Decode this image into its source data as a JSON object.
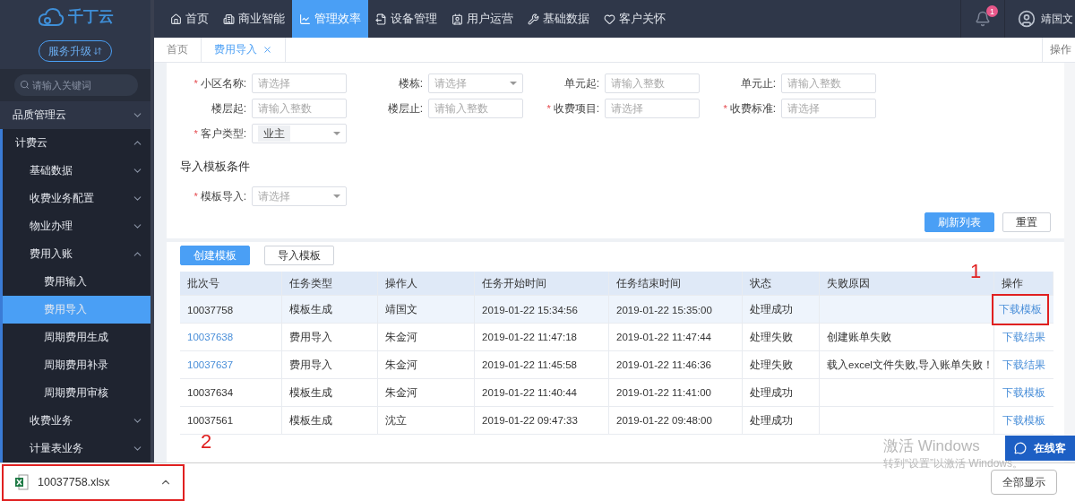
{
  "logo": {
    "text": "千丁云"
  },
  "upgrade_button": {
    "label": "服务升级"
  },
  "sidebar_search": {
    "placeholder": "请输入关键词"
  },
  "sidebar": {
    "items": [
      {
        "label": "品质管理云",
        "expanded": false,
        "selected": false
      },
      {
        "label": "计费云",
        "expanded": true,
        "selected": false,
        "children": [
          {
            "label": "基础数据",
            "expanded": false,
            "selected": false
          },
          {
            "label": "收费业务配置",
            "expanded": false,
            "selected": false
          },
          {
            "label": "物业办理",
            "expanded": false,
            "selected": false
          },
          {
            "label": "费用入账",
            "expanded": true,
            "selected": false,
            "children": [
              {
                "label": "费用输入",
                "selected": false
              },
              {
                "label": "费用导入",
                "selected": true
              },
              {
                "label": "周期费用生成",
                "selected": false
              },
              {
                "label": "周期费用补录",
                "selected": false
              },
              {
                "label": "周期费用审核",
                "selected": false
              }
            ]
          },
          {
            "label": "收费业务",
            "expanded": false,
            "selected": false
          },
          {
            "label": "计量表业务",
            "expanded": false,
            "selected": false
          }
        ]
      }
    ]
  },
  "nav": [
    {
      "label": "首页",
      "selected": false
    },
    {
      "label": "商业智能",
      "selected": false
    },
    {
      "label": "管理效率",
      "selected": true
    },
    {
      "label": "设备管理",
      "selected": false
    },
    {
      "label": "用户运营",
      "selected": false
    },
    {
      "label": "基础数据",
      "selected": false
    },
    {
      "label": "客户关怀",
      "selected": false
    }
  ],
  "notifications": {
    "badge": "1"
  },
  "user": {
    "name": "靖国文"
  },
  "tabs": [
    {
      "label": "首页",
      "selected": false,
      "closable": false
    },
    {
      "label": "费用导入",
      "selected": true,
      "closable": true
    }
  ],
  "tab_actions": {
    "label": "操作"
  },
  "form": {
    "required_mark": "*",
    "fields": [
      {
        "label": "小区名称:",
        "required": true,
        "kind": "input",
        "placeholder": "请选择"
      },
      {
        "label": "楼栋:",
        "required": false,
        "kind": "select",
        "placeholder": "请选择"
      },
      {
        "label": "单元起:",
        "required": false,
        "kind": "input",
        "placeholder": "请输入整数"
      },
      {
        "label": "单元止:",
        "required": false,
        "kind": "input",
        "placeholder": "请输入整数"
      },
      {
        "label": "楼层起:",
        "required": false,
        "kind": "input",
        "placeholder": "请输入整数"
      },
      {
        "label": "楼层止:",
        "required": false,
        "kind": "input",
        "placeholder": "请输入整数"
      },
      {
        "label": "收费项目:",
        "required": true,
        "kind": "input",
        "placeholder": "请选择"
      },
      {
        "label": "收费标准:",
        "required": true,
        "kind": "input",
        "placeholder": "请选择"
      },
      {
        "label": "客户类型:",
        "required": true,
        "kind": "select",
        "value": "业主"
      }
    ],
    "section_title": "导入模板条件",
    "template_field": {
      "label": "模板导入:",
      "required": true,
      "kind": "select",
      "placeholder": "请选择"
    },
    "buttons": [
      {
        "label": "刷新列表",
        "primary": true
      },
      {
        "label": "重置",
        "primary": false
      }
    ]
  },
  "table_buttons": [
    {
      "label": "创建模板",
      "primary": true
    },
    {
      "label": "导入模板",
      "primary": false
    }
  ],
  "table": {
    "columns": [
      "批次号",
      "任务类型",
      "操作人",
      "任务开始时间",
      "任务结束时间",
      "状态",
      "失败原因",
      "操作"
    ],
    "rows": [
      {
        "link": false,
        "hovered": true,
        "cells": [
          "10037758",
          "模板生成",
          "靖国文",
          "2019-01-22 15:34:56",
          "2019-01-22 15:35:00",
          "处理成功",
          ""
        ],
        "action": "下载模板",
        "highlighted": true
      },
      {
        "link": true,
        "hovered": false,
        "cells": [
          "10037638",
          "费用导入",
          "朱金河",
          "2019-01-22 11:47:18",
          "2019-01-22 11:47:44",
          "处理失败",
          "创建账单失败"
        ],
        "action": "下载结果",
        "highlighted": false
      },
      {
        "link": true,
        "hovered": false,
        "cells": [
          "10037637",
          "费用导入",
          "朱金河",
          "2019-01-22 11:45:58",
          "2019-01-22 11:46:36",
          "处理失败",
          "载入excel文件失败,导入账单失败！"
        ],
        "action": "下载结果",
        "highlighted": false
      },
      {
        "link": false,
        "hovered": false,
        "cells": [
          "10037634",
          "模板生成",
          "朱金河",
          "2019-01-22 11:40:44",
          "2019-01-22 11:41:00",
          "处理成功",
          ""
        ],
        "action": "下载模板",
        "highlighted": false
      },
      {
        "link": false,
        "hovered": false,
        "cells": [
          "10037561",
          "模板生成",
          "沈立",
          "2019-01-22 09:47:33",
          "2019-01-22 09:48:00",
          "处理成功",
          ""
        ],
        "action": "下载模板",
        "highlighted": false
      }
    ]
  },
  "annotations": [
    "1",
    "2"
  ],
  "chat_widget": {
    "label": "在线客"
  },
  "windows_notice": {
    "title": "激活 Windows",
    "subtitle": "转到“设置”以激活 Windows。"
  },
  "download_bar": {
    "file": "10037758.xlsx",
    "highlighted": true,
    "show_all": "全部显示"
  }
}
